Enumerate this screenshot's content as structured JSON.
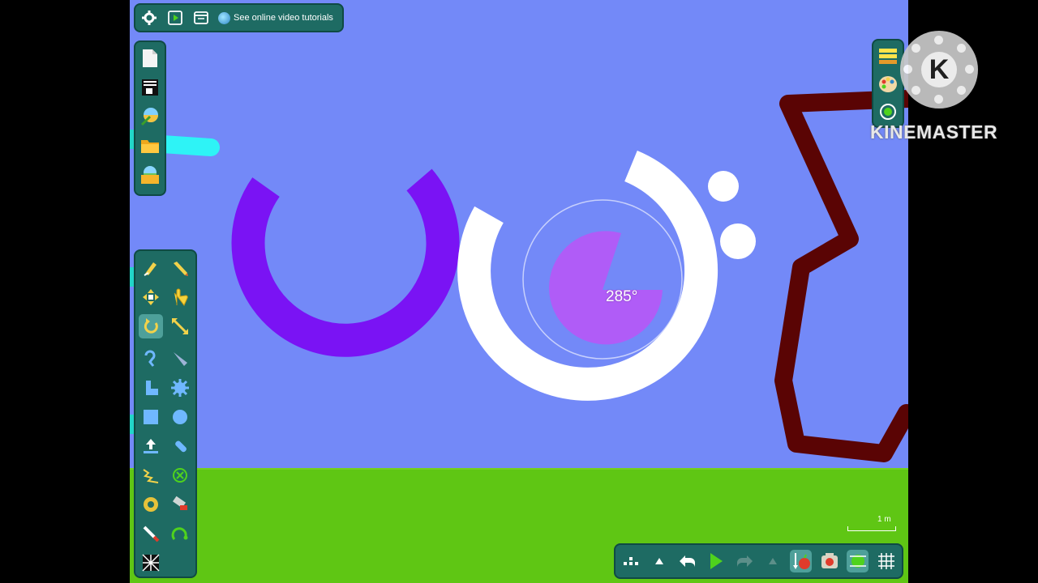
{
  "toolbar": {
    "tutorial_link": "See online video tutorials",
    "icons": [
      "gear-icon",
      "play-icon",
      "window-icon",
      "globe-icon"
    ]
  },
  "file_panel": {
    "items": [
      "new-scene",
      "text-box",
      "edit-properties",
      "open-folder",
      "image-folder"
    ]
  },
  "tools": {
    "active": "rotate",
    "items": [
      "sketch",
      "pencil",
      "move",
      "drag",
      "rotate",
      "scale",
      "rope",
      "knife",
      "polygon",
      "gear",
      "box",
      "circle",
      "thruster",
      "plane",
      "spring",
      "fixate",
      "hinge",
      "laser",
      "pen",
      "tracer",
      "texture"
    ]
  },
  "canvas": {
    "rotation_readout": "285°",
    "scale_label": "1 m",
    "sky_color": "#7389f8",
    "ground_color": "#5fc614"
  },
  "bottom_bar": {
    "items": [
      "menu",
      "expand-up",
      "undo",
      "play",
      "redo",
      "expand-up-2",
      "gravity",
      "camera-follow",
      "grid-snap",
      "grid"
    ],
    "active": [
      "gravity",
      "grid-snap"
    ]
  },
  "watermark": {
    "text": "KINEMASTER",
    "logo_letter": "K"
  }
}
